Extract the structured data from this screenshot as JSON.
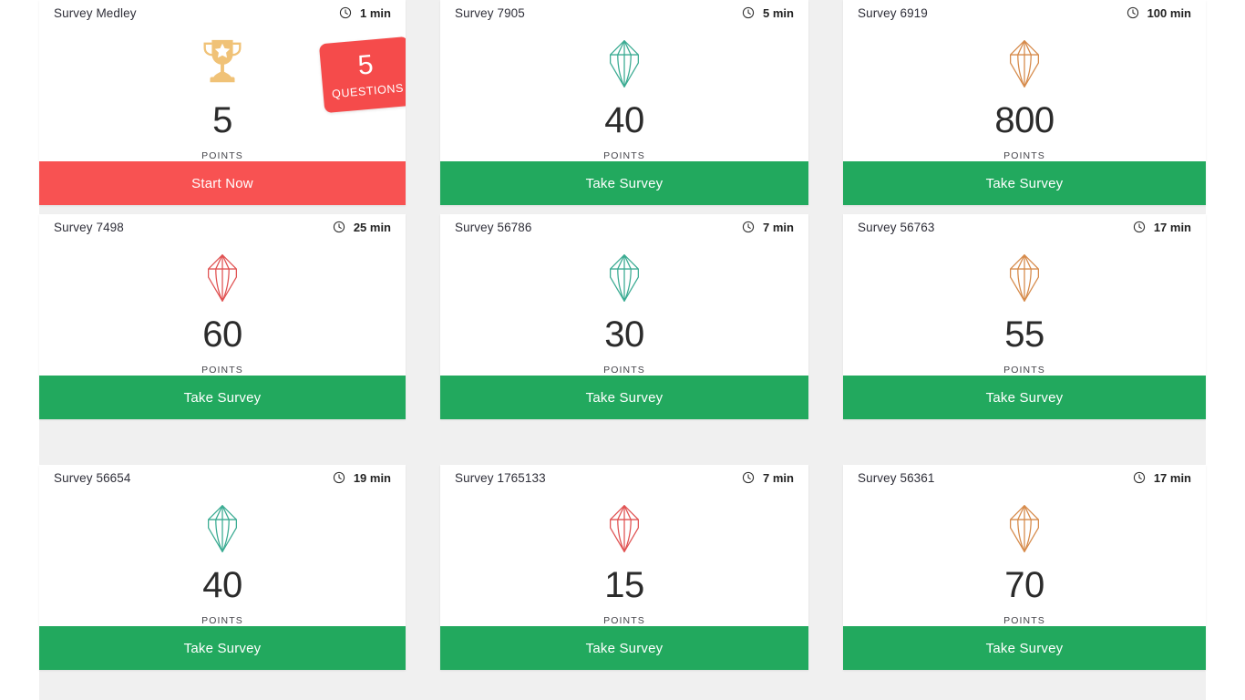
{
  "theme": {
    "page_background": "#ffffff",
    "grid_background": "#f0f0f0",
    "card_background": "#ffffff",
    "accent_green": "#22a95e",
    "accent_red": "#f85252",
    "badge_red": "#f54b4b",
    "gem_teal": "#3aab92",
    "gem_orange": "#d68a4a",
    "gem_red": "#e05252",
    "trophy_gold": "#f0c277",
    "title_color": "#2e2e38",
    "points_color": "#2b2b2b"
  },
  "labels": {
    "points": "POINTS",
    "questions": "QUESTIONS",
    "clock_icon": "clock-icon"
  },
  "cards": [
    {
      "title": "Survey Medley",
      "duration": "1 min",
      "points": "5",
      "points_label": "POINTS",
      "icon": "trophy-icon",
      "icon_color": "#f0c277",
      "button_label": "Start Now",
      "button_style": "red",
      "featured": true,
      "questions_count": "5",
      "questions_label": "QUESTIONS"
    },
    {
      "title": "Survey 7905",
      "duration": "5 min",
      "points": "40",
      "points_label": "POINTS",
      "icon": "gem-icon",
      "icon_color": "#3aab92",
      "button_label": "Take Survey",
      "button_style": "green",
      "featured": false
    },
    {
      "title": "Survey 6919",
      "duration": "100 min",
      "points": "800",
      "points_label": "POINTS",
      "icon": "gem-icon",
      "icon_color": "#d68a4a",
      "button_label": "Take Survey",
      "button_style": "green",
      "featured": false
    },
    {
      "title": "Survey 7498",
      "duration": "25 min",
      "points": "60",
      "points_label": "POINTS",
      "icon": "gem-icon",
      "icon_color": "#e05252",
      "button_label": "Take Survey",
      "button_style": "green",
      "featured": false
    },
    {
      "title": "Survey 56786",
      "duration": "7 min",
      "points": "30",
      "points_label": "POINTS",
      "icon": "gem-icon",
      "icon_color": "#3aab92",
      "button_label": "Take Survey",
      "button_style": "green",
      "featured": false
    },
    {
      "title": "Survey 56763",
      "duration": "17 min",
      "points": "55",
      "points_label": "POINTS",
      "icon": "gem-icon",
      "icon_color": "#d68a4a",
      "button_label": "Take Survey",
      "button_style": "green",
      "featured": false
    },
    {
      "title": "Survey 56654",
      "duration": "19 min",
      "points": "40",
      "points_label": "POINTS",
      "icon": "gem-icon",
      "icon_color": "#3aab92",
      "button_label": "Take Survey",
      "button_style": "green",
      "featured": false
    },
    {
      "title": "Survey 1765133",
      "duration": "7 min",
      "points": "15",
      "points_label": "POINTS",
      "icon": "gem-icon",
      "icon_color": "#e05252",
      "button_label": "Take Survey",
      "button_style": "green",
      "featured": false
    },
    {
      "title": "Survey 56361",
      "duration": "17 min",
      "points": "70",
      "points_label": "POINTS",
      "icon": "gem-icon",
      "icon_color": "#d68a4a",
      "button_label": "Take Survey",
      "button_style": "green",
      "featured": false
    }
  ]
}
